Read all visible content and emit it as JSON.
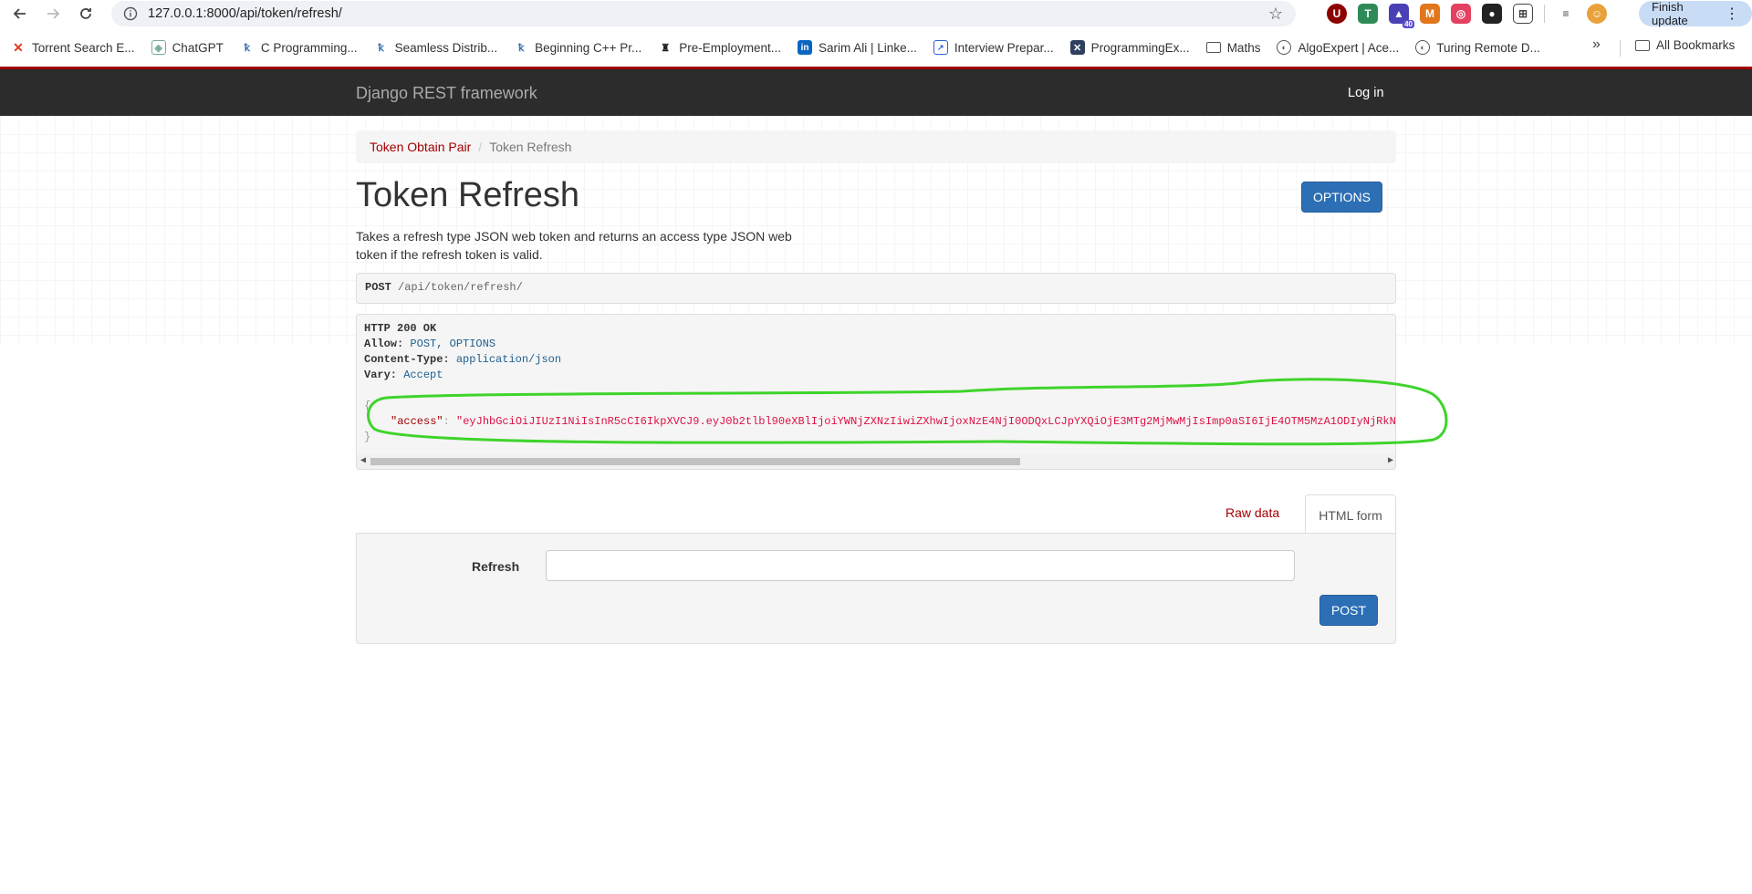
{
  "browser": {
    "url": "127.0.0.1:8000/api/token/refresh/",
    "finish_update_label": "Finish update",
    "extension_badge": "40",
    "bookmarks": [
      {
        "label": "Torrent Search E...",
        "icon": "x-icon"
      },
      {
        "label": "ChatGPT",
        "icon": "chatgpt-icon"
      },
      {
        "label": "C Programming...",
        "icon": "book-icon"
      },
      {
        "label": "Seamless Distrib...",
        "icon": "book-icon"
      },
      {
        "label": "Beginning C++ Pr...",
        "icon": "book-icon"
      },
      {
        "label": "Pre-Employment...",
        "icon": "tower-icon"
      },
      {
        "label": "Sarim Ali | Linke...",
        "icon": "linkedin-icon"
      },
      {
        "label": "Interview Prepar...",
        "icon": "chart-icon"
      },
      {
        "label": "ProgrammingEx...",
        "icon": "x-box-icon"
      },
      {
        "label": "Maths",
        "icon": "folder-icon"
      },
      {
        "label": "AlgoExpert | Ace...",
        "icon": "globe-icon"
      },
      {
        "label": "Turing Remote D...",
        "icon": "globe-icon"
      }
    ],
    "all_bookmarks_label": "All Bookmarks"
  },
  "navbar": {
    "brand": "Django REST framework",
    "login": "Log in"
  },
  "breadcrumb": {
    "items": [
      "Token Obtain Pair",
      "Token Refresh"
    ]
  },
  "page": {
    "title": "Token Refresh",
    "options_label": "OPTIONS",
    "description": "Takes a refresh type JSON web token and returns an access type JSON web token if the refresh token is valid."
  },
  "request": {
    "method": "POST",
    "path": "/api/token/refresh/"
  },
  "response": {
    "status": "HTTP 200 OK",
    "headers": [
      {
        "name": "Allow:",
        "value": "POST, OPTIONS"
      },
      {
        "name": "Content-Type:",
        "value": "application/json"
      },
      {
        "name": "Vary:",
        "value": "Accept"
      }
    ],
    "open_brace": "{",
    "close_brace": "}",
    "json_key": "\"access\"",
    "json_value": "\"eyJhbGciOiJIUzI1NiIsInR5cCI6IkpXVCJ9.eyJ0b2tlbl90eXBlIjoiYWNjZXNzIiwiZXhwIjoxNzE4NjI0ODQxLCJpYXQiOjE3MTg2MjMwMjIsImp0aSI6IjE4OTM5MzA1ODIyNjRkN"
  },
  "form": {
    "tab_raw": "Raw data",
    "tab_html": "HTML form",
    "field_label": "Refresh",
    "field_value": "",
    "submit_label": "POST"
  },
  "colors": {
    "drf_red": "#a30000",
    "navbar_bg": "#2c2c2c",
    "primary_blue": "#2c6fb5",
    "json_string": "#dd1144",
    "annotation_green": "#3ed42b"
  }
}
